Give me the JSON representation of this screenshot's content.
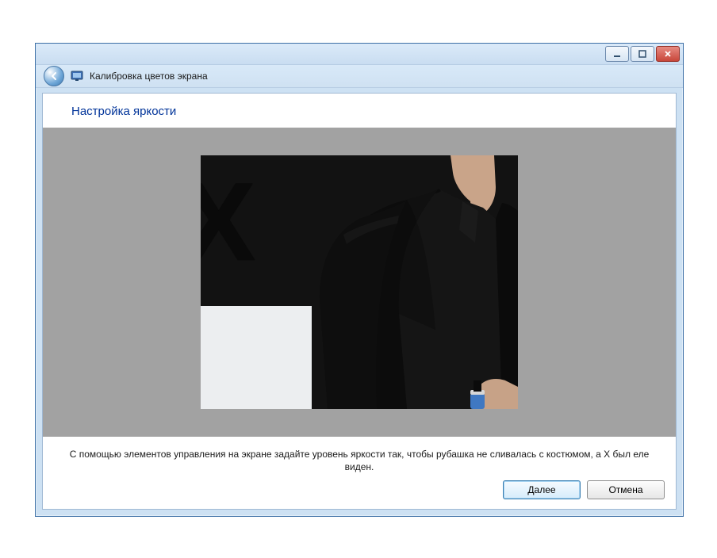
{
  "window": {
    "title": "Калибровка цветов экрана"
  },
  "page": {
    "heading": "Настройка яркости",
    "instruction": "С помощью элементов управления на экране задайте уровень яркости так, чтобы рубашка не сливалась с костюмом, а X был еле виден."
  },
  "buttons": {
    "next": "Далее",
    "cancel": "Отмена"
  },
  "calibration_image": {
    "x_glyph": "X"
  }
}
